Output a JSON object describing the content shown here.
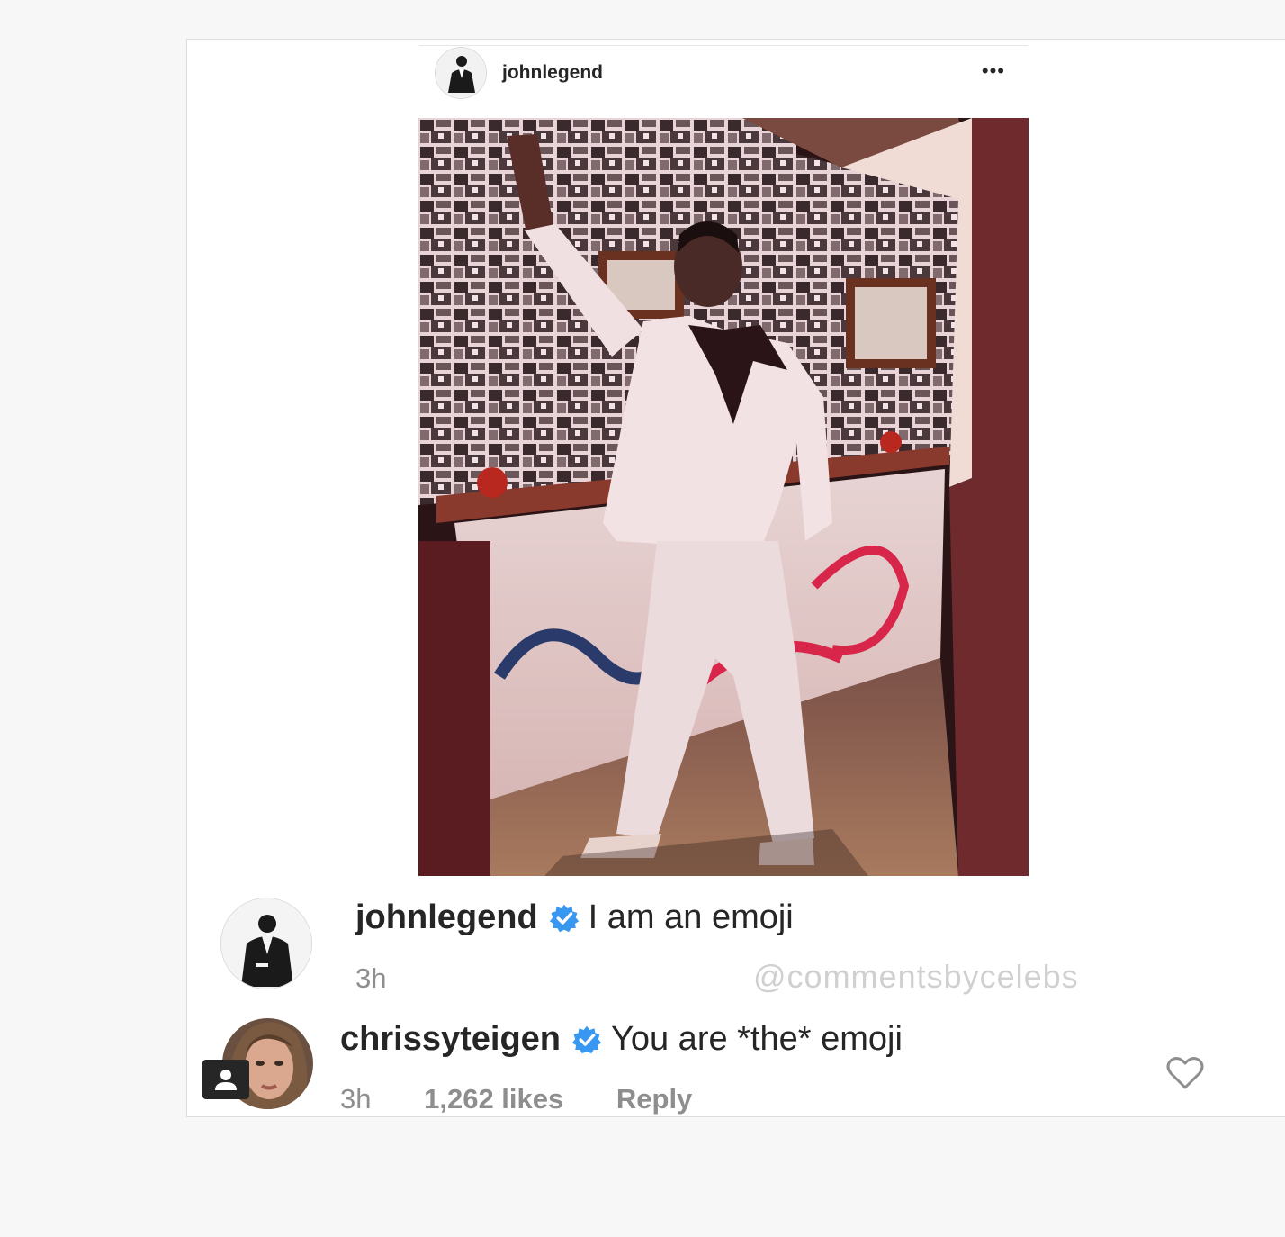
{
  "post": {
    "username": "johnlegend",
    "more_icon": "more-options-icon",
    "more_label": "•••",
    "photo_icon": "post-photo"
  },
  "comments": [
    {
      "username": "johnlegend",
      "verified": true,
      "text": "I am an emoji",
      "time": "3h"
    },
    {
      "username": "chrissyteigen",
      "verified": true,
      "text": "You are *the* emoji",
      "time": "3h",
      "likes": "1,262 likes",
      "reply": "Reply"
    }
  ],
  "watermark": "@commentsbycelebs",
  "colors": {
    "verified_blue": "#3897f0",
    "text": "#262626",
    "meta_gray": "#8e8e8e"
  }
}
